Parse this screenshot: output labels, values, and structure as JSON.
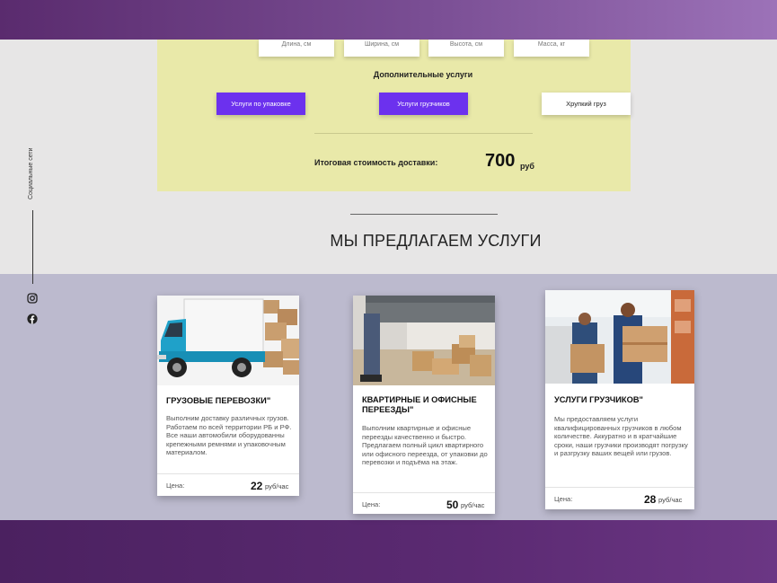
{
  "calculator": {
    "dimensions": [
      "Длина, см",
      "Ширина, см",
      "Высота, см",
      "Масса, кг"
    ],
    "extra_services_title": "Дополнительные услуги",
    "options": [
      {
        "label": "Услуги по упаковке",
        "selected": true
      },
      {
        "label": "Услуги грузчиков",
        "selected": true
      },
      {
        "label": "Хрупкий груз",
        "selected": false
      }
    ],
    "total_label": "Итоговая стоимость доставки:",
    "total_value": "700",
    "total_unit": "руб"
  },
  "section": {
    "title": "МЫ ПРЕДЛАГАЕМ УСЛУГИ"
  },
  "social": {
    "label": "Социальные сети",
    "icons": [
      "instagram-icon",
      "facebook-icon"
    ]
  },
  "cards": [
    {
      "title": "ГРУЗОВЫЕ ПЕРЕВОЗКИ\"",
      "description": "Выполним доставку различных грузов. Работаем по всей территории РБ и РФ. Все наши автомобили оборудованны крепежными ремнями и упаковочным материалом.",
      "price_label": "Цена:",
      "price_value": "22",
      "price_unit": "руб/час"
    },
    {
      "title": "КВАРТИРНЫЕ И ОФИСНЫЕ ПЕРЕЕЗДЫ\"",
      "description": "Выполним квартирные и офисные переезды качественно и быстро. Предлагаем полный цикл квартирного или офисного переезда, от упаковки до перевозки и подъёма на этаж.",
      "price_label": "Цена:",
      "price_value": "50",
      "price_unit": "руб/час"
    },
    {
      "title": "УСЛУГИ ГРУЗЧИКОВ\"",
      "description": "Мы предоставляем услуги квалифицированных грузчиков в любом количестве. Аккуратно и в кратчайшие сроки, наши грузчики производят погрузку и разгрузку ваших вещей или грузов.",
      "price_label": "Цена:",
      "price_value": "28",
      "price_unit": "руб/час"
    }
  ],
  "colors": {
    "accent": "#6c31ee",
    "calculator_bg": "#e9e9a9",
    "band": "#5b2a72",
    "lilac": "#bcbace"
  }
}
